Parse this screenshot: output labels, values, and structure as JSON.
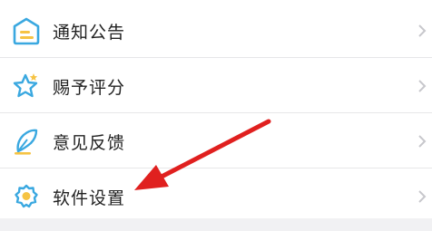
{
  "menu": {
    "items": [
      {
        "label": "通知公告",
        "icon": "notice-icon"
      },
      {
        "label": "赐予评分",
        "icon": "star-rating-icon"
      },
      {
        "label": "意见反馈",
        "icon": "feedback-feather-icon"
      },
      {
        "label": "软件设置",
        "icon": "settings-gear-icon"
      }
    ]
  },
  "colors": {
    "icon_blue": "#3aa8e0",
    "icon_yellow": "#f6c343",
    "arrow_red": "#e0201f",
    "chevron": "#c7c7cc"
  }
}
